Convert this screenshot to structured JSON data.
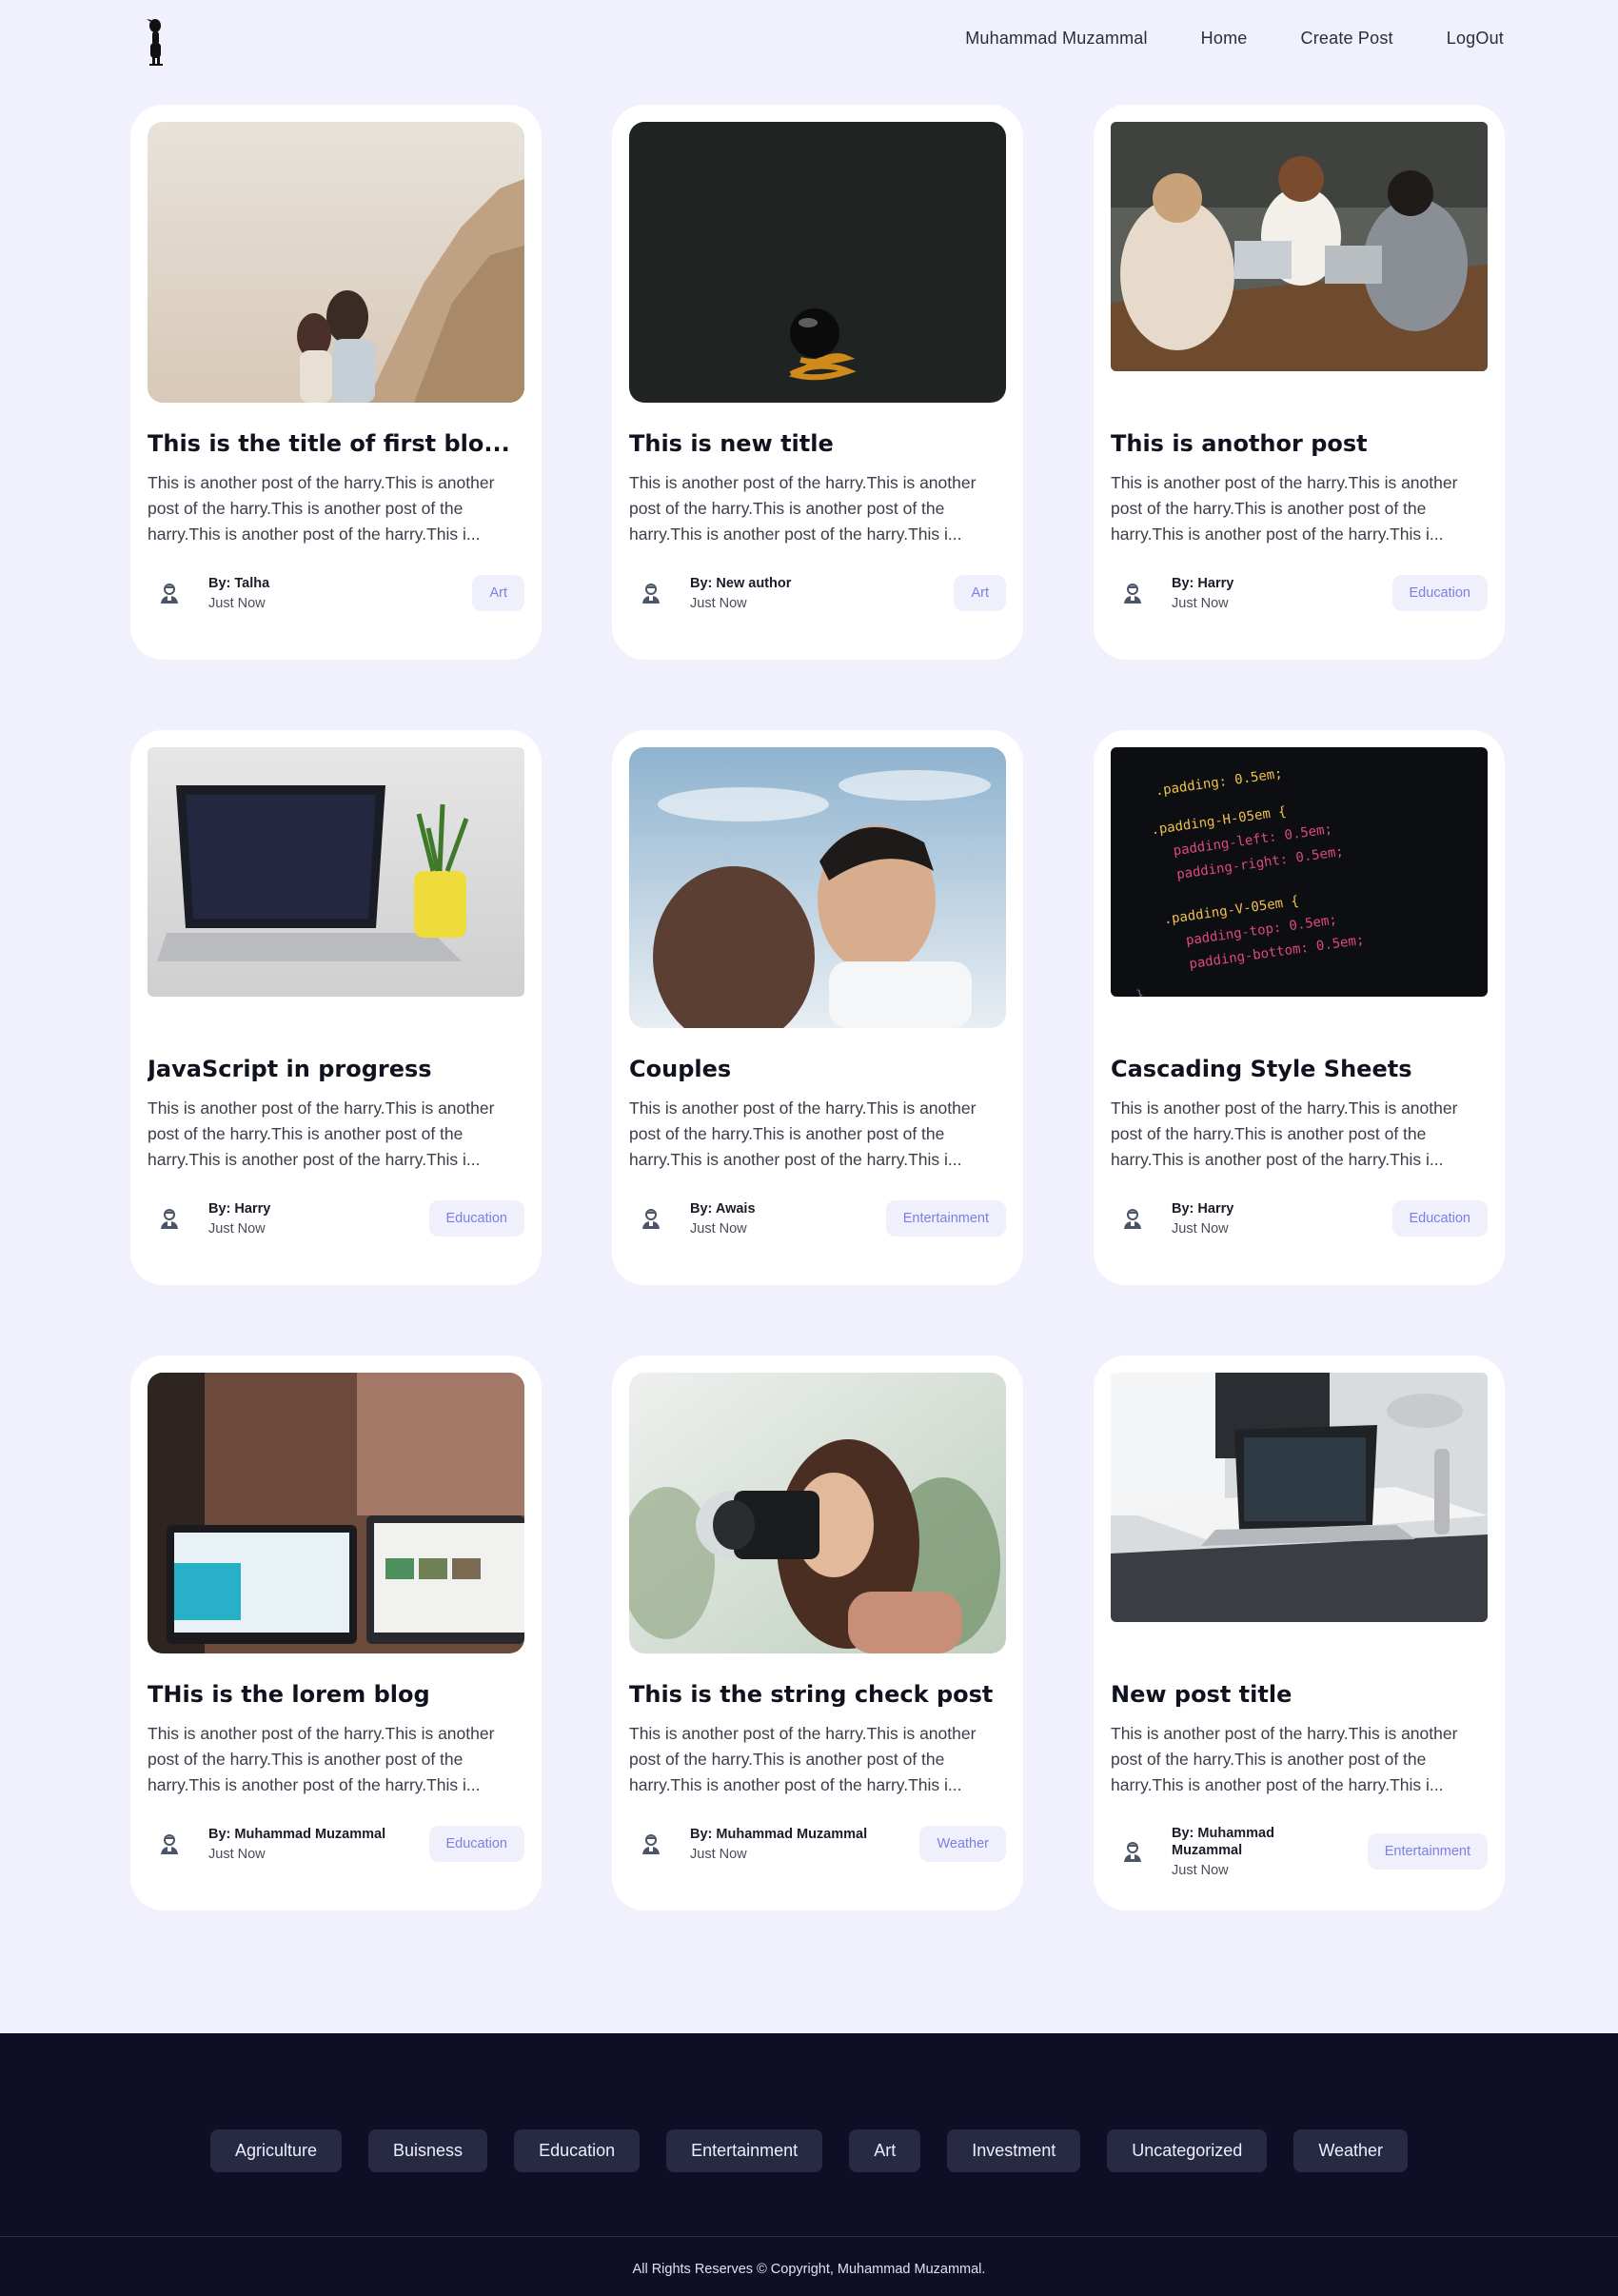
{
  "header": {
    "nav": [
      "Muhammad Muzammal",
      "Home",
      "Create Post",
      "LogOut"
    ]
  },
  "posts": [
    {
      "title": "This is the title of first blo...",
      "excerpt": "This is another post of the harry.This is another post of the harry.This is another post of the harry.This is another post of the harry.This i...",
      "author": "Talha",
      "time": "Just Now",
      "tag": "Art",
      "image": "couple-cliff-photo"
    },
    {
      "title": "This is new title",
      "excerpt": "This is another post of the harry.This is another post of the harry.This is another post of the harry.This is another post of the harry.This i...",
      "author": "New author",
      "time": "Just Now",
      "tag": "Art",
      "image": "dark-sphere-spring-photo"
    },
    {
      "title": "This is anothor post",
      "excerpt": "This is another post of the harry.This is another post of the harry.This is another post of the harry.This is another post of the harry.This i...",
      "author": "Harry",
      "time": "Just Now",
      "tag": "Education",
      "image": "friends-laptops-photo"
    },
    {
      "title": "JavaScript in progress",
      "excerpt": "This is another post of the harry.This is another post of the harry.This is another post of the harry.This is another post of the harry.This i...",
      "author": "Harry",
      "time": "Just Now",
      "tag": "Education",
      "image": "laptop-code-plant-photo"
    },
    {
      "title": "Couples",
      "excerpt": "This is another post of the harry.This is another post of the harry.This is another post of the harry.This is another post of the harry.This i...",
      "author": "Awais",
      "time": "Just Now",
      "tag": "Entertainment",
      "image": "couple-sky-photo"
    },
    {
      "title": "Cascading Style Sheets",
      "excerpt": "This is another post of the harry.This is another post of the harry.This is another post of the harry.This is another post of the harry.This i...",
      "author": "Harry",
      "time": "Just Now",
      "tag": "Education",
      "image": "css-code-photo"
    },
    {
      "title": "THis is the lorem blog",
      "excerpt": "This is another post of the harry.This is another post of the harry.This is another post of the harry.This is another post of the harry.This i...",
      "author": "Muhammad Muzammal",
      "time": "Just Now",
      "tag": "Education",
      "image": "two-screens-photo"
    },
    {
      "title": "This is the string check post",
      "excerpt": "This is another post of the harry.This is another post of the harry.This is another post of the harry.This is another post of the harry.This i...",
      "author": "Muhammad Muzammal",
      "time": "Just Now",
      "tag": "Weather",
      "image": "woman-camera-photo"
    },
    {
      "title": "New post title",
      "excerpt": "This is another post of the harry.This is another post of the harry.This is another post of the harry.This is another post of the harry.This i...",
      "author": "Muhammad Muzammal",
      "time": "Just Now",
      "tag": "Entertainment",
      "image": "desk-workspace-photo"
    }
  ],
  "by_prefix": "By: ",
  "footer": {
    "categories": [
      "Agriculture",
      "Buisness",
      "Education",
      "Entertainment",
      "Art",
      "Investment",
      "Uncategorized",
      "Weather"
    ],
    "copyright": "All Rights Reserves © Copyright, Muhammad Muzammal."
  },
  "colors": {
    "page_bg": "#f0f1fc",
    "footer_bg": "#0e0f26",
    "tag_bg": "#f0f0fd",
    "tag_text": "#7b7ee6"
  }
}
